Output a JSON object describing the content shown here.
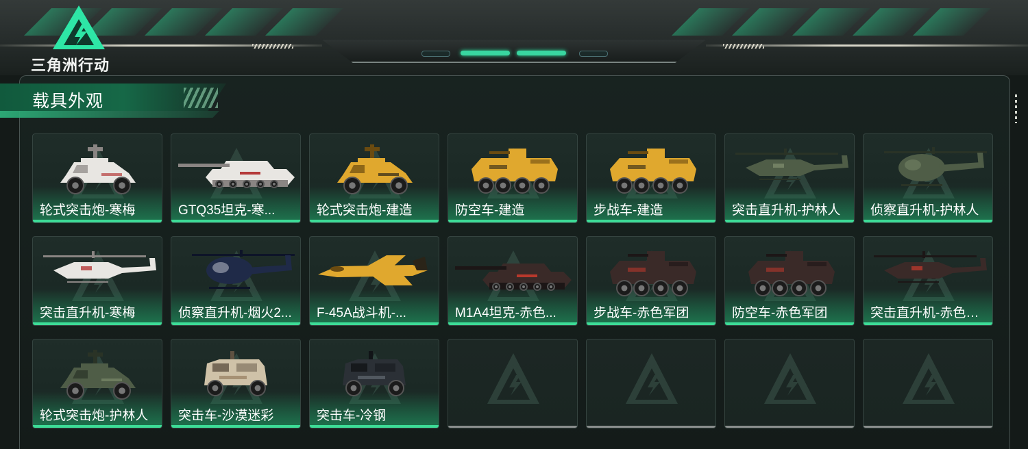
{
  "header": {
    "game_title": "三角洲行动"
  },
  "section": {
    "title": "载具外观"
  },
  "colors": {
    "accent": "#3ddc97",
    "panel_bg": "#141b19"
  },
  "vehicles": [
    {
      "name": "轮式突击炮-寒梅",
      "kind": "armored-car",
      "scheme": "snow"
    },
    {
      "name": "GTQ35坦克-寒...",
      "kind": "tank",
      "scheme": "snow"
    },
    {
      "name": "轮式突击炮-建造",
      "kind": "armored-car",
      "scheme": "yellow"
    },
    {
      "name": "防空车-建造",
      "kind": "apc",
      "scheme": "yellow"
    },
    {
      "name": "步战车-建造",
      "kind": "apc",
      "scheme": "yellow"
    },
    {
      "name": "突击直升机-护林人",
      "kind": "attack-heli",
      "scheme": "forest"
    },
    {
      "name": "侦察直升机-护林人",
      "kind": "scout-heli",
      "scheme": "forest"
    },
    {
      "name": "突击直升机-寒梅",
      "kind": "attack-heli",
      "scheme": "snow"
    },
    {
      "name": "侦察直升机-烟火2...",
      "kind": "scout-heli",
      "scheme": "navy"
    },
    {
      "name": "F-45A战斗机-...",
      "kind": "jet",
      "scheme": "yellow"
    },
    {
      "name": "M1A4坦克-赤色...",
      "kind": "tank",
      "scheme": "red"
    },
    {
      "name": "步战车-赤色军团",
      "kind": "apc",
      "scheme": "red"
    },
    {
      "name": "防空车-赤色军团",
      "kind": "apc",
      "scheme": "red"
    },
    {
      "name": "突击直升机-赤色军...",
      "kind": "attack-heli",
      "scheme": "red"
    },
    {
      "name": "轮式突击炮-护林人",
      "kind": "armored-car",
      "scheme": "forest"
    },
    {
      "name": "突击车-沙漠迷彩",
      "kind": "mrap",
      "scheme": "desert"
    },
    {
      "name": "突击车-冷钢",
      "kind": "mrap",
      "scheme": "steel"
    },
    {
      "name": null,
      "kind": "empty",
      "scheme": null
    },
    {
      "name": null,
      "kind": "empty",
      "scheme": null
    },
    {
      "name": null,
      "kind": "empty",
      "scheme": null
    },
    {
      "name": null,
      "kind": "empty",
      "scheme": null
    }
  ]
}
